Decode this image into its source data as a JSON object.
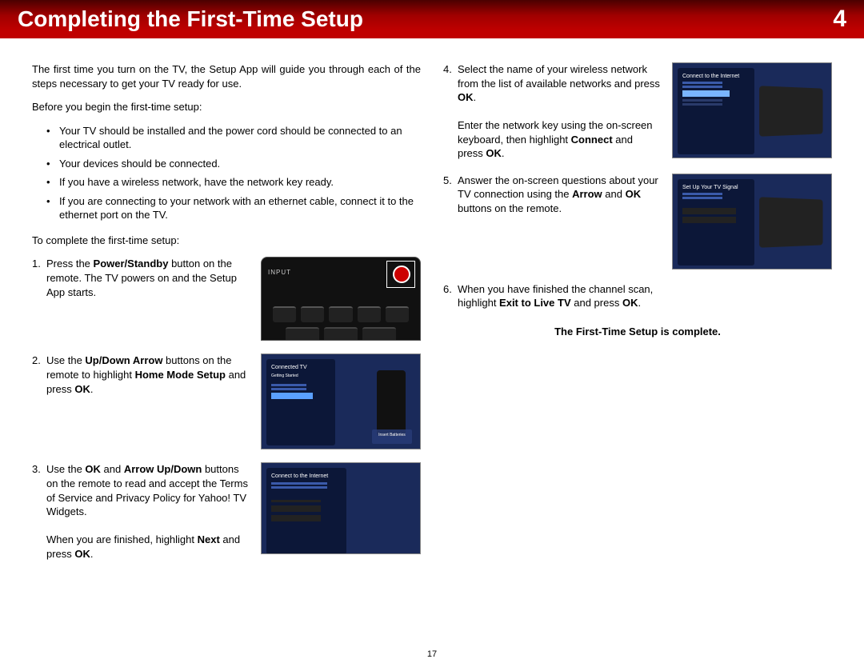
{
  "header": {
    "title": "Completing the First-Time Setup",
    "chapter_number": "4"
  },
  "intro": "The first time you turn on the TV, the Setup App will guide you through each of the steps necessary to get your TV ready for use.",
  "before_heading": "Before you begin the first-time setup:",
  "before_bullets": [
    "Your TV should be installed and the power cord should be connected to an electrical outlet.",
    "Your devices should be connected.",
    "If you have a wireless network, have the network key ready.",
    "If you are connecting to your network with an ethernet cable, connect it to the ethernet port on the TV."
  ],
  "complete_heading": "To complete the first-time setup:",
  "steps_left": [
    {
      "n": "1.",
      "pre": "Press the ",
      "b": "Power/Standby",
      "post": " button on the remote. The TV powers on and the Setup App starts."
    },
    {
      "n": "2.",
      "pre": "Use the ",
      "b": "Up/Down Arrow",
      "post": " buttons on the remote to highlight ",
      "b2": "Home Mode Setup",
      "post2": " and press ",
      "b3": "OK",
      "post3": "."
    },
    {
      "n": "3.",
      "pre": "Use the ",
      "b": "OK",
      "mid": " and ",
      "b2": "Arrow Up/Down",
      "post": " buttons on the remote to read and accept the Terms of Service and Privacy Policy for Yahoo! TV Widgets.",
      "extra_pre": "When you are finished, highlight ",
      "extra_b": "Next",
      "extra_mid": " and press ",
      "extra_b2": "OK",
      "extra_post": "."
    }
  ],
  "steps_right": [
    {
      "n": "4.",
      "text_parts": [
        "Select the name of your wireless network from the list of available networks and press ",
        "OK",
        ".",
        "",
        "Enter the network key using the on-screen keyboard, then highlight ",
        "Connect",
        " and press ",
        "OK",
        "."
      ]
    },
    {
      "n": "5.",
      "text_parts": [
        "Answer the on-screen questions about your TV connection using the ",
        "Arrow",
        " and ",
        "OK",
        " buttons on the remote."
      ]
    },
    {
      "n": "6.",
      "text_parts": [
        "When you have finished the channel scan, highlight ",
        "Exit to Live TV",
        " and press ",
        "OK",
        "."
      ]
    }
  ],
  "complete_text": "The First-Time Setup is complete.",
  "page_number": "17",
  "screen_labels": {
    "connected_tv": "Connected TV",
    "getting_started": "Getting Started",
    "connect_internet": "Connect to the Internet",
    "setup_signal": "Set Up Your TV Signal",
    "insert_batteries": "Insert Batteries"
  }
}
